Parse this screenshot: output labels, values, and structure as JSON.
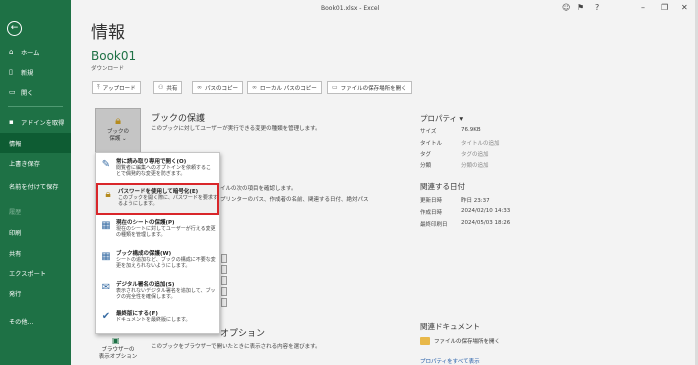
{
  "window": {
    "title": "Book01.xlsx - Excel"
  },
  "sidebar": {
    "items": [
      {
        "label": "ホーム",
        "icon": "home-icon"
      },
      {
        "label": "新規",
        "icon": "new-document-icon"
      },
      {
        "label": "開く",
        "icon": "open-folder-icon"
      },
      {
        "label": "アドインを取得"
      },
      {
        "label": "情報"
      },
      {
        "label": "上書き保存"
      },
      {
        "label": "名前を付けて保存"
      },
      {
        "label": "履歴"
      },
      {
        "label": "印刷"
      },
      {
        "label": "共有"
      },
      {
        "label": "エクスポート"
      },
      {
        "label": "発行"
      },
      {
        "label": "その他..."
      }
    ]
  },
  "main": {
    "title": "情報",
    "workbook_name": "Book01",
    "workbook_location": "ダウンロード",
    "toolbar": {
      "upload": "アップロード",
      "share": "共有",
      "copy_path": "パスのコピー",
      "copy_local_path": "ローカル パスのコピー",
      "open_file_location": "ファイルの保存場所を開く"
    },
    "protect": {
      "button_label_1": "ブックの",
      "button_label_2": "保護 ⌄",
      "title": "ブックの保護",
      "desc": "このブックに対してユーザーが実行できる変更の種類を管理します。"
    },
    "inspect": {
      "line1": "イルの次の項目を確認します。",
      "line2": "プリンターのパス、作成者の名前、関連する日付、絶対パス"
    },
    "browser": {
      "title": "オプション",
      "desc": "このブックをブラウザーで開いたときに表示される内容を選びます。",
      "button_label_1": "ブラウザーの",
      "button_label_2": "表示オプション"
    }
  },
  "protect_menu": [
    {
      "title": "常に読み取り専用で開く(O)",
      "desc": "閲覧者に編集へのオプトインを依頼することで偶発的な変更を防ぎます。"
    },
    {
      "title": "パスワードを使用して暗号化(E)",
      "desc": "このブックを開く際に、パスワードを要求するようにします。"
    },
    {
      "title": "現在のシートの保護(P)",
      "desc": "現在のシートに対してユーザーが行える変更の種類を管理します。"
    },
    {
      "title": "ブック構成の保護(W)",
      "desc": "シートの追加など、ブックの構成に不要な変更を加えられないようにします。"
    },
    {
      "title": "デジタル署名の追加(S)",
      "desc": "表示されないデジタル署名を追加して、ブックの完全性を確保します。"
    },
    {
      "title": "最終版にする(F)",
      "desc": "ドキュメントを最終版にします。"
    }
  ],
  "properties": {
    "heading": "プロパティ ▾",
    "rows": [
      {
        "key": "サイズ",
        "value": "76.9KB",
        "muted": false
      },
      {
        "key": "タイトル",
        "value": "タイトルの追加",
        "muted": true
      },
      {
        "key": "タグ",
        "value": "タグの追加",
        "muted": true
      },
      {
        "key": "分類",
        "value": "分類の追加",
        "muted": true
      }
    ]
  },
  "related_dates": {
    "heading": "関連する日付",
    "rows": [
      {
        "key": "更新日時",
        "value": "昨日 23:37"
      },
      {
        "key": "作成日時",
        "value": "2024/02/10 14:33"
      },
      {
        "key": "最終印刷日",
        "value": "2024/05/03 18:26"
      }
    ]
  },
  "related_docs": {
    "heading": "関連ドキュメント",
    "open_location": "ファイルの保存場所を開く",
    "show_all": "プロパティをすべて表示"
  },
  "colors": {
    "accent": "#1e7145",
    "highlight": "#d9262a"
  }
}
